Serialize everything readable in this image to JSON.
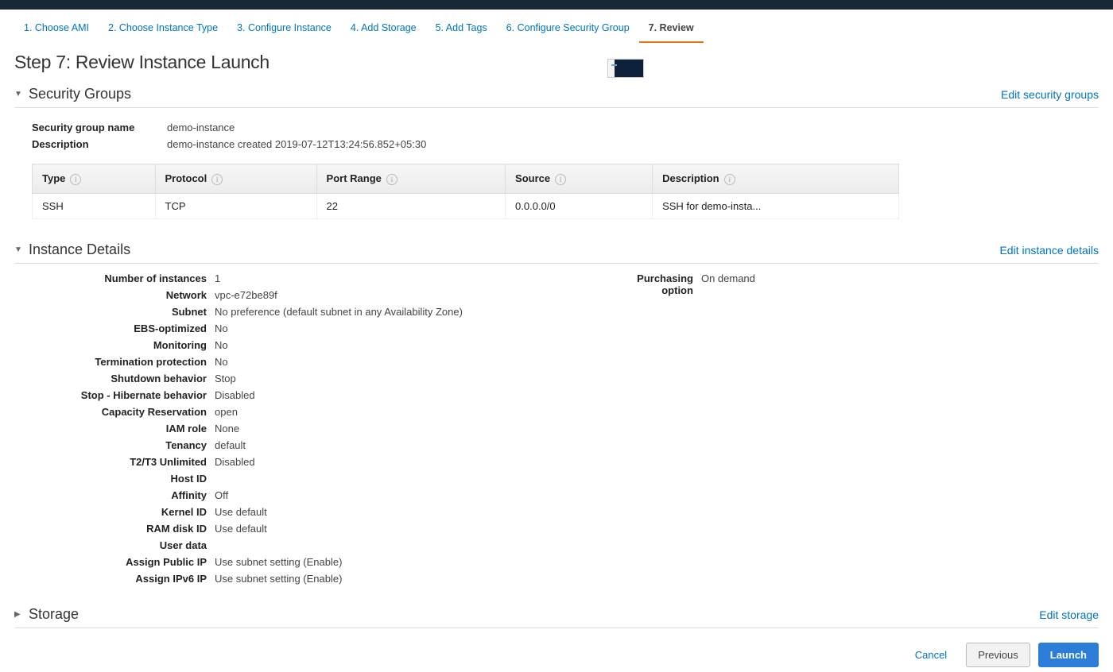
{
  "steps": [
    "1. Choose AMI",
    "2. Choose Instance Type",
    "3. Configure Instance",
    "4. Add Storage",
    "5. Add Tags",
    "6. Configure Security Group",
    "7. Review"
  ],
  "active_step_index": 6,
  "title": "Step 7: Review Instance Launch",
  "sections": {
    "security_groups": {
      "heading": "Security Groups",
      "edit": "Edit security groups",
      "name_label": "Security group name",
      "name_value": "demo-instance",
      "desc_label": "Description",
      "desc_value": "demo-instance created 2019-07-12T13:24:56.852+05:30",
      "columns": [
        "Type",
        "Protocol",
        "Port Range",
        "Source",
        "Description"
      ],
      "rows": [
        [
          "SSH",
          "TCP",
          "22",
          "0.0.0.0/0",
          "SSH for demo-insta..."
        ]
      ]
    },
    "instance_details": {
      "heading": "Instance Details",
      "edit": "Edit instance details",
      "left": [
        {
          "label": "Number of instances",
          "value": "1"
        },
        {
          "label": "Network",
          "value": "vpc-e72be89f"
        },
        {
          "label": "Subnet",
          "value": "No preference (default subnet in any Availability Zone)"
        },
        {
          "label": "EBS-optimized",
          "value": "No"
        },
        {
          "label": "Monitoring",
          "value": "No"
        },
        {
          "label": "Termination protection",
          "value": "No"
        },
        {
          "label": "Shutdown behavior",
          "value": "Stop"
        },
        {
          "label": "Stop - Hibernate behavior",
          "value": "Disabled"
        },
        {
          "label": "Capacity Reservation",
          "value": "open"
        },
        {
          "label": "IAM role",
          "value": "None"
        },
        {
          "label": "Tenancy",
          "value": "default"
        },
        {
          "label": "T2/T3 Unlimited",
          "value": "Disabled"
        },
        {
          "label": "Host ID",
          "value": ""
        },
        {
          "label": "Affinity",
          "value": "Off"
        },
        {
          "label": "Kernel ID",
          "value": "Use default"
        },
        {
          "label": "RAM disk ID",
          "value": "Use default"
        },
        {
          "label": "User data",
          "value": ""
        },
        {
          "label": "Assign Public IP",
          "value": "Use subnet setting (Enable)"
        },
        {
          "label": "Assign IPv6 IP",
          "value": "Use subnet setting (Enable)"
        }
      ],
      "right": [
        {
          "label": "Purchasing option",
          "value": "On demand"
        }
      ]
    },
    "storage": {
      "heading": "Storage",
      "edit": "Edit storage"
    }
  },
  "buttons": {
    "cancel": "Cancel",
    "previous": "Previous",
    "launch": "Launch"
  }
}
